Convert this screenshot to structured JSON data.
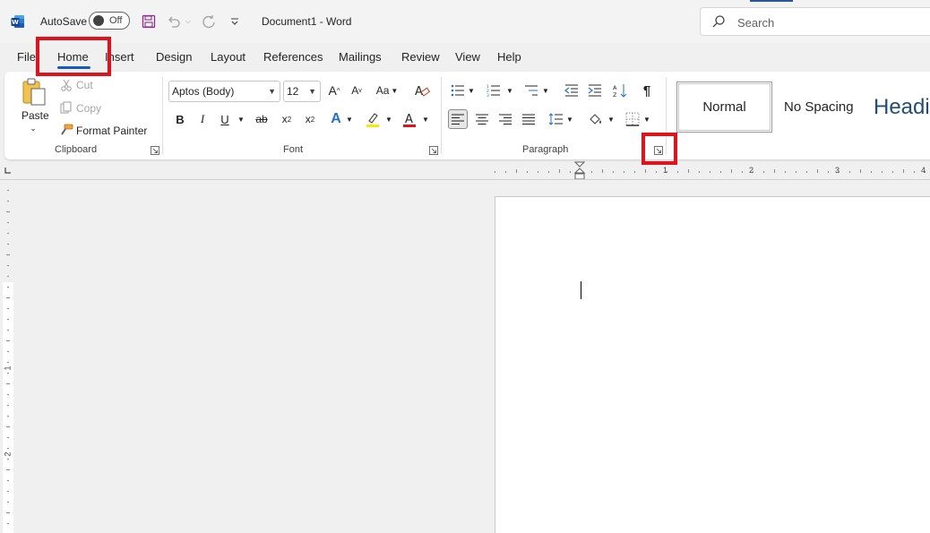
{
  "titlebar": {
    "autosave_label": "AutoSave",
    "toggle_state": "Off",
    "doc_title": "Document1  -  Word",
    "search_placeholder": "Search"
  },
  "tabs": [
    "File",
    "Home",
    "Insert",
    "Design",
    "Layout",
    "References",
    "Mailings",
    "Review",
    "View",
    "Help"
  ],
  "active_tab": "Home",
  "clipboard": {
    "paste": "Paste",
    "cut": "Cut",
    "copy": "Copy",
    "format_painter": "Format Painter",
    "label": "Clipboard"
  },
  "font": {
    "name": "Aptos (Body)",
    "size": "12",
    "label": "Font"
  },
  "paragraph": {
    "label": "Paragraph"
  },
  "styles": {
    "normal": "Normal",
    "no_spacing": "No Spacing",
    "heading": "Headi"
  },
  "ruler": {
    "numbers": [
      "1",
      "2",
      "3",
      "4"
    ],
    "vertical_numbers": [
      "1",
      "2"
    ]
  },
  "colors": {
    "accent": "#185abd",
    "highlight_box": "#e0121b",
    "word_blue": "#2b579a"
  }
}
